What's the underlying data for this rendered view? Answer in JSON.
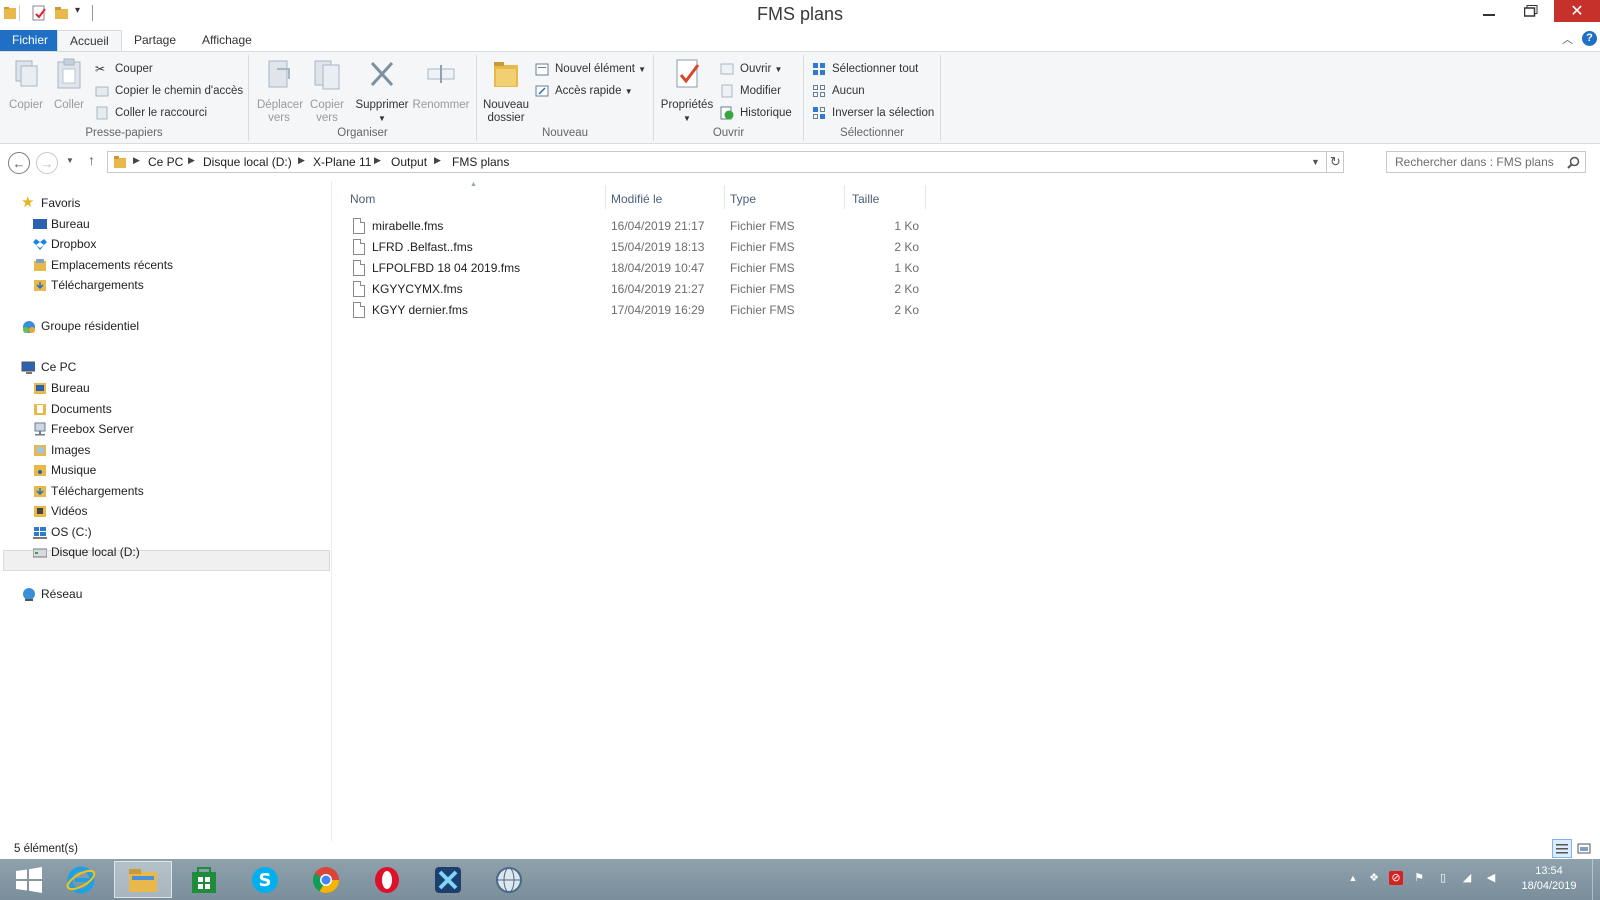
{
  "window": {
    "title": "FMS plans"
  },
  "colors": {
    "accent": "#1f6fc5",
    "close": "#c7312b",
    "folder": "#e8b84a",
    "header_text": "#4c607a"
  },
  "tabs": [
    {
      "label": "Fichier",
      "active": false
    },
    {
      "label": "Accueil",
      "active": true
    },
    {
      "label": "Partage",
      "active": false
    },
    {
      "label": "Affichage",
      "active": false
    }
  ],
  "ribbon": {
    "clipboard": {
      "copy": "Copier",
      "paste": "Coller",
      "cut": "Couper",
      "copy_path": "Copier le chemin d'accès",
      "paste_shortcut": "Coller le raccourci",
      "label": "Presse-papiers"
    },
    "organize": {
      "move": "Déplacer vers",
      "copyto": "Copier vers",
      "delete": "Supprimer",
      "rename": "Renommer",
      "label": "Organiser"
    },
    "new": {
      "new_folder": "Nouveau dossier",
      "new_item": "Nouvel élément",
      "quick_access": "Accès rapide",
      "label": "Nouveau"
    },
    "open": {
      "properties": "Propriétés",
      "open": "Ouvrir",
      "edit": "Modifier",
      "history": "Historique",
      "label": "Ouvrir"
    },
    "select": {
      "select_all": "Sélectionner tout",
      "none": "Aucun",
      "invert": "Inverser la sélection",
      "label": "Sélectionner"
    }
  },
  "address": {
    "crumbs": [
      "Ce PC",
      "Disque local (D:)",
      "X-Plane 11",
      "Output",
      "FMS plans"
    ],
    "search_placeholder": "Rechercher dans : FMS plans"
  },
  "nav": {
    "favorites": {
      "label": "Favoris",
      "items": [
        "Bureau",
        "Dropbox",
        "Emplacements récents",
        "Téléchargements"
      ]
    },
    "homegroup": "Groupe résidentiel",
    "thispc": {
      "label": "Ce PC",
      "items": [
        "Bureau",
        "Documents",
        "Freebox Server",
        "Images",
        "Musique",
        "Téléchargements",
        "Vidéos",
        "OS (C:)",
        "Disque local (D:)"
      ]
    },
    "network": "Réseau"
  },
  "columns": {
    "name": "Nom",
    "modified": "Modifié le",
    "type": "Type",
    "size": "Taille"
  },
  "files": [
    {
      "name": "mirabelle.fms",
      "modified": "16/04/2019 21:17",
      "type": "Fichier FMS",
      "size": "1 Ko"
    },
    {
      "name": "LFRD .Belfast..fms",
      "modified": "15/04/2019 18:13",
      "type": "Fichier FMS",
      "size": "2 Ko"
    },
    {
      "name": "LFPOLFBD 18 04 2019.fms",
      "modified": "18/04/2019 10:47",
      "type": "Fichier FMS",
      "size": "1 Ko"
    },
    {
      "name": "KGYYCYMX.fms",
      "modified": "16/04/2019 21:27",
      "type": "Fichier FMS",
      "size": "2 Ko"
    },
    {
      "name": "KGYY dernier.fms",
      "modified": "17/04/2019 16:29",
      "type": "Fichier FMS",
      "size": "2 Ko"
    }
  ],
  "status": {
    "count": "5 élément(s)"
  },
  "taskbar": {
    "time": "13:54",
    "date": "18/04/2019"
  }
}
